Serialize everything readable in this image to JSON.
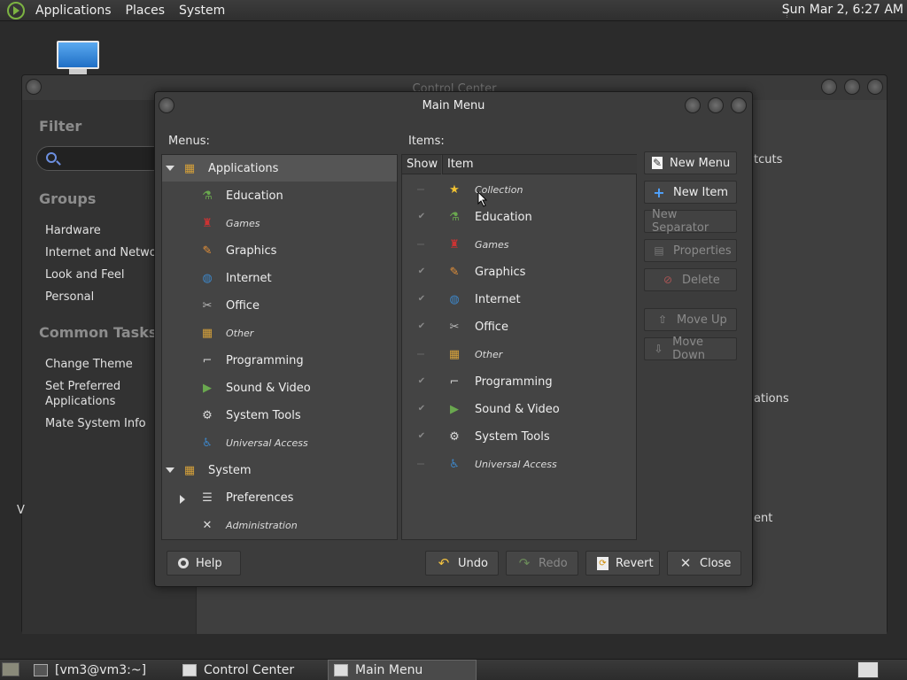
{
  "top_panel": {
    "menus": [
      "Applications",
      "Places",
      "System"
    ],
    "clock": "Sun Mar  2,  6:27 AM"
  },
  "control_center": {
    "title": "Control Center",
    "filter_heading": "Filter",
    "groups_heading": "Groups",
    "groups": [
      "Hardware",
      "Internet and Networ",
      "Look and Feel",
      "Personal"
    ],
    "tasks_heading": "Common Tasks",
    "tasks": [
      "Change Theme",
      "Set Preferred\nApplications",
      "Mate System Info"
    ],
    "fragments": [
      "tcuts",
      "ations",
      "ent",
      "V"
    ]
  },
  "main_menu": {
    "title": "Main Menu",
    "menus_label": "Menus:",
    "items_label": "Items:",
    "menus_tree": [
      {
        "label": "Applications",
        "level": 0,
        "expander": "open",
        "italic": false,
        "icon": "applications-icon",
        "selected": true
      },
      {
        "label": "Education",
        "level": 1,
        "italic": false,
        "icon": "education-icon"
      },
      {
        "label": "Games",
        "level": 1,
        "italic": true,
        "icon": "games-icon"
      },
      {
        "label": "Graphics",
        "level": 1,
        "italic": false,
        "icon": "graphics-icon"
      },
      {
        "label": "Internet",
        "level": 1,
        "italic": false,
        "icon": "internet-icon"
      },
      {
        "label": "Office",
        "level": 1,
        "italic": false,
        "icon": "office-icon"
      },
      {
        "label": "Other",
        "level": 1,
        "italic": true,
        "icon": "other-icon"
      },
      {
        "label": "Programming",
        "level": 1,
        "italic": false,
        "icon": "programming-icon"
      },
      {
        "label": "Sound & Video",
        "level": 1,
        "italic": false,
        "icon": "sound-video-icon"
      },
      {
        "label": "System Tools",
        "level": 1,
        "italic": false,
        "icon": "system-tools-icon"
      },
      {
        "label": "Universal Access",
        "level": 1,
        "italic": true,
        "icon": "universal-access-icon"
      },
      {
        "label": "System",
        "level": 0,
        "expander": "open",
        "italic": false,
        "icon": "system-icon"
      },
      {
        "label": "Preferences",
        "level": 1,
        "expander": "closed",
        "italic": false,
        "icon": "preferences-icon"
      },
      {
        "label": "Administration",
        "level": 1,
        "italic": true,
        "icon": "administration-icon"
      }
    ],
    "items_columns": {
      "show": "Show",
      "item": "Item"
    },
    "items": [
      {
        "label": "Collection",
        "show": false,
        "italic": true,
        "icon": "star-icon"
      },
      {
        "label": "Education",
        "show": true,
        "italic": false,
        "icon": "education-icon"
      },
      {
        "label": "Games",
        "show": false,
        "italic": true,
        "icon": "games-icon"
      },
      {
        "label": "Graphics",
        "show": true,
        "italic": false,
        "icon": "graphics-icon"
      },
      {
        "label": "Internet",
        "show": true,
        "italic": false,
        "icon": "internet-icon"
      },
      {
        "label": "Office",
        "show": true,
        "italic": false,
        "icon": "office-icon"
      },
      {
        "label": "Other",
        "show": false,
        "italic": true,
        "icon": "other-icon"
      },
      {
        "label": "Programming",
        "show": true,
        "italic": false,
        "icon": "programming-icon"
      },
      {
        "label": "Sound & Video",
        "show": true,
        "italic": false,
        "icon": "sound-video-icon"
      },
      {
        "label": "System Tools",
        "show": true,
        "italic": false,
        "icon": "system-tools-icon"
      },
      {
        "label": "Universal Access",
        "show": false,
        "italic": true,
        "icon": "universal-access-icon"
      }
    ],
    "buttons": {
      "new_menu": "New Menu",
      "new_item": "New Item",
      "new_separator": "New Separator",
      "properties": "Properties",
      "delete": "Delete",
      "move_up": "Move Up",
      "move_down": "Move Down",
      "help": "Help",
      "undo": "Undo",
      "redo": "Redo",
      "revert": "Revert",
      "close": "Close"
    }
  },
  "taskbar": {
    "tasks": [
      {
        "label": "[vm3@vm3:~]",
        "active": false
      },
      {
        "label": "Control Center",
        "active": false
      },
      {
        "label": "Main Menu",
        "active": true
      }
    ]
  },
  "colors": {
    "panel": "#2f2f2f",
    "window": "#3c3c3c",
    "selection": "#555555",
    "accent_green": "#7cb342"
  }
}
